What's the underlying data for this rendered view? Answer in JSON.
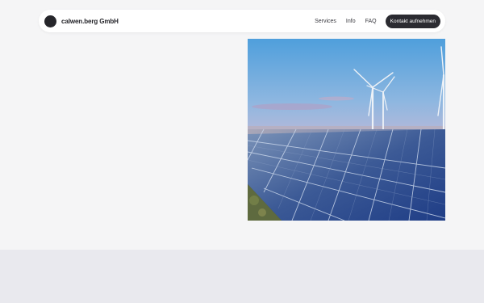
{
  "header": {
    "brand": "calwen.berg GmbH",
    "nav": [
      "Services",
      "Info",
      "FAQ"
    ],
    "cta_label": "Kontakt aufnehmen"
  },
  "hero": {
    "image_subject": "wind turbines and solar panels at sunset"
  },
  "colors": {
    "page_background": "#f5f5f6",
    "bottom_band": "#e9e9ee",
    "button": "#2b2b31",
    "logo": "#26262b"
  }
}
